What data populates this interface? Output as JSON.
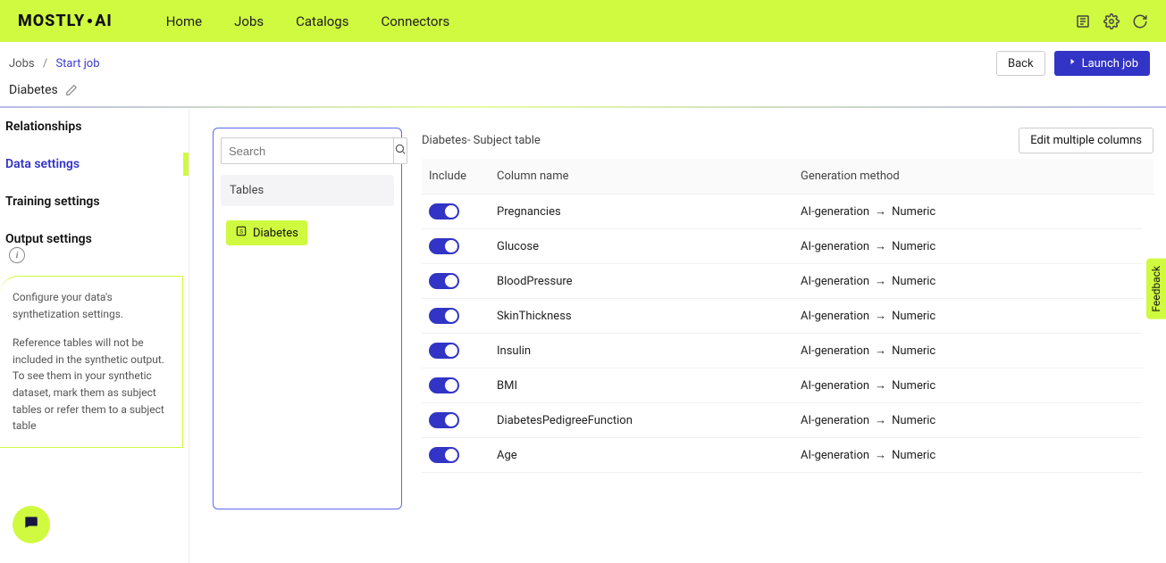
{
  "brand": {
    "logo_1": "MOSTLY",
    "logo_2": "AI"
  },
  "nav": {
    "home": "Home",
    "jobs": "Jobs",
    "catalogs": "Catalogs",
    "connectors": "Connectors"
  },
  "breadcrumbs": {
    "parent": "Jobs",
    "current": "Start job"
  },
  "buttons": {
    "back": "Back",
    "launch": "Launch job",
    "edit_multiple": "Edit multiple columns"
  },
  "job": {
    "title": "Diabetes"
  },
  "sidebar": {
    "relationships": "Relationships",
    "data_settings": "Data settings",
    "training_settings": "Training settings",
    "output_settings": "Output settings",
    "info_p1": "Configure your data's synthetization settings.",
    "info_p2": "Reference tables will not be included in the synthetic output. To see them in your synthetic dataset, mark them as subject tables or refer them to a subject table"
  },
  "tables": {
    "search_placeholder": "Search",
    "header": "Tables",
    "selected": "Diabetes"
  },
  "columns": {
    "subject_label": "Diabetes- Subject table",
    "header_include": "Include",
    "header_name": "Column name",
    "header_method": "Generation method",
    "method_prefix": "AI-generation",
    "method_arrow": "→",
    "rows": [
      {
        "name": "Pregnancies",
        "method_suffix": "Numeric",
        "include": true
      },
      {
        "name": "Glucose",
        "method_suffix": "Numeric",
        "include": true
      },
      {
        "name": "BloodPressure",
        "method_suffix": "Numeric",
        "include": true
      },
      {
        "name": "SkinThickness",
        "method_suffix": "Numeric",
        "include": true
      },
      {
        "name": "Insulin",
        "method_suffix": "Numeric",
        "include": true
      },
      {
        "name": "BMI",
        "method_suffix": "Numeric",
        "include": true
      },
      {
        "name": "DiabetesPedigreeFunction",
        "method_suffix": "Numeric",
        "include": true
      },
      {
        "name": "Age",
        "method_suffix": "Numeric",
        "include": true
      }
    ]
  },
  "feedback": "Feedback"
}
